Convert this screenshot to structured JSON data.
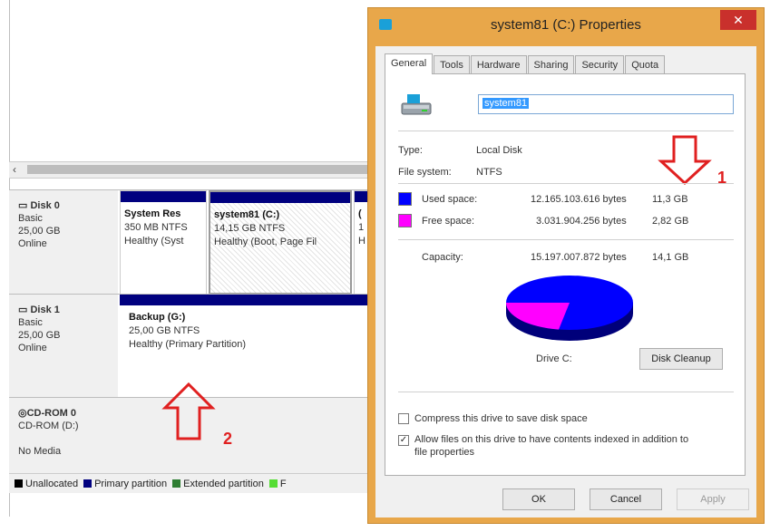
{
  "disk_management": {
    "disks": [
      {
        "name": "Disk 0",
        "type": "Basic",
        "size": "25,00 GB",
        "status": "Online",
        "partitions": [
          {
            "name": "System Res",
            "size": "350 MB NTFS",
            "status": "Healthy (Syst"
          },
          {
            "name": "system81 (C:)",
            "size": "14,15 GB NTFS",
            "status": "Healthy (Boot, Page Fil"
          },
          {
            "name": "(",
            "size": "1",
            "status": "H"
          }
        ]
      },
      {
        "name": "Disk 1",
        "type": "Basic",
        "size": "25,00 GB",
        "status": "Online",
        "partitions": [
          {
            "name": "Backup (G:)",
            "size": "25,00 GB NTFS",
            "status": "Healthy (Primary Partition)"
          }
        ]
      },
      {
        "name": "CD-ROM 0",
        "type": "CD-ROM (D:)",
        "size": "",
        "status": "No Media"
      }
    ],
    "legend": [
      {
        "label": "Unallocated",
        "color": "#000000"
      },
      {
        "label": "Primary partition",
        "color": "#00007f"
      },
      {
        "label": "Extended partition",
        "color": "#2e7d32"
      },
      {
        "label": "F",
        "color": "#55dd33"
      }
    ]
  },
  "annotations": {
    "arrow1_label": "1",
    "arrow2_label": "2",
    "color": "#e02020"
  },
  "dialog": {
    "title": "system81 (C:) Properties",
    "close_label": "✕",
    "tabs": [
      "General",
      "Tools",
      "Hardware",
      "Sharing",
      "Security",
      "Quota"
    ],
    "active_tab": "General",
    "volume_name": "system81",
    "type_label": "Type:",
    "type_value": "Local Disk",
    "fs_label": "File system:",
    "fs_value": "NTFS",
    "used": {
      "label": "Used space:",
      "bytes": "12.165.103.616 bytes",
      "gb": "11,3 GB",
      "color": "#0000ff"
    },
    "free": {
      "label": "Free space:",
      "bytes": "3.031.904.256 bytes",
      "gb": "2,82 GB",
      "color": "#ff00ff"
    },
    "capacity": {
      "label": "Capacity:",
      "bytes": "15.197.007.872 bytes",
      "gb": "14,1 GB"
    },
    "drive_label": "Drive C:",
    "cleanup_button": "Disk Cleanup",
    "compress_label": "Compress this drive to save disk space",
    "compress_checked": false,
    "index_label_1": "Allow files on this drive to have contents indexed in addition to",
    "index_label_2": "file properties",
    "index_checked": true,
    "ok_button": "OK",
    "cancel_button": "Cancel",
    "apply_button": "Apply"
  }
}
